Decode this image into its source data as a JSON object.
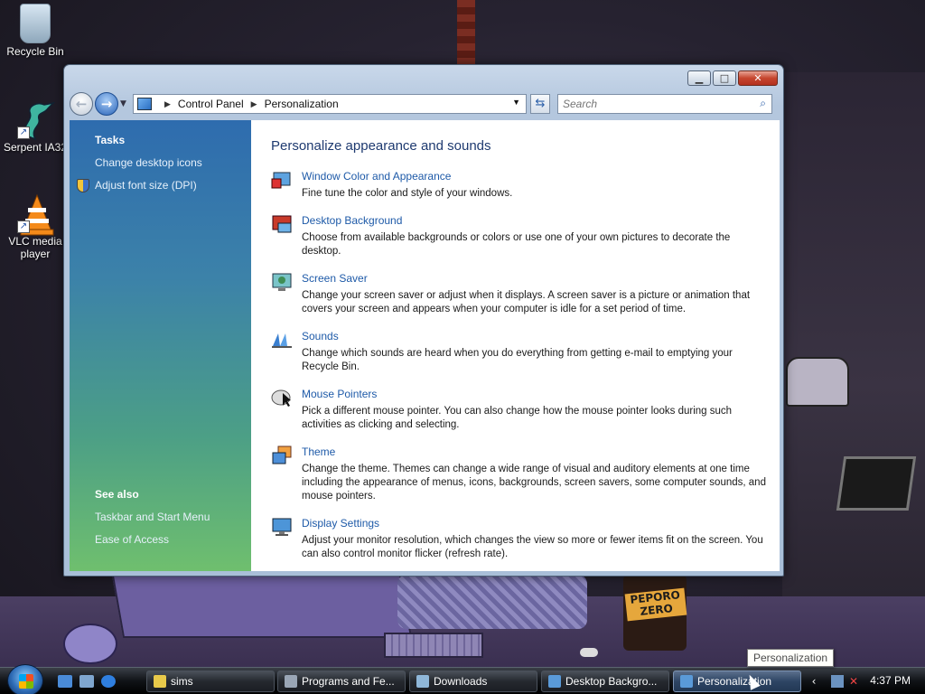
{
  "desktop": {
    "icons": [
      {
        "label": "Recycle Bin",
        "icon": "recycle-bin-icon"
      },
      {
        "label": "Serpent IA32",
        "icon": "serpent-icon"
      },
      {
        "label": "VLC media player",
        "icon": "vlc-icon"
      }
    ],
    "bottle_text": "PEPORO ZERO"
  },
  "window": {
    "address": {
      "root": "Control Panel",
      "current": "Personalization"
    },
    "search_placeholder": "Search",
    "sidebar": {
      "tasks_heading": "Tasks",
      "tasks": [
        "Change desktop icons",
        "Adjust font size (DPI)"
      ],
      "see_also_heading": "See also",
      "see_also": [
        "Taskbar and Start Menu",
        "Ease of Access"
      ]
    },
    "content": {
      "heading": "Personalize appearance and sounds",
      "items": [
        {
          "title": "Window Color and Appearance",
          "desc": "Fine tune the color and style of your windows.",
          "icon": "window-color-icon"
        },
        {
          "title": "Desktop Background",
          "desc": "Choose from available backgrounds or colors or use one of your own pictures to decorate the desktop.",
          "icon": "desktop-background-icon"
        },
        {
          "title": "Screen Saver",
          "desc": "Change your screen saver or adjust when it displays. A screen saver is a picture or animation that covers your screen and appears when your computer is idle for a set period of time.",
          "icon": "screen-saver-icon"
        },
        {
          "title": "Sounds",
          "desc": "Change which sounds are heard when you do everything from getting e-mail to emptying your Recycle Bin.",
          "icon": "sounds-icon"
        },
        {
          "title": "Mouse Pointers",
          "desc": "Pick a different mouse pointer. You can also change how the mouse pointer looks during such activities as clicking and selecting.",
          "icon": "mouse-pointers-icon"
        },
        {
          "title": "Theme",
          "desc": "Change the theme. Themes can change a wide range of visual and auditory elements at one time including the appearance of menus, icons, backgrounds, screen savers, some computer sounds, and mouse pointers.",
          "icon": "theme-icon"
        },
        {
          "title": "Display Settings",
          "desc": "Adjust your monitor resolution, which changes the view so more or fewer items fit on the screen. You can also control monitor flicker (refresh rate).",
          "icon": "display-settings-icon"
        }
      ]
    }
  },
  "taskbar": {
    "tasks": [
      {
        "label": "sims",
        "active": false
      },
      {
        "label": "Programs and Fe...",
        "active": false
      },
      {
        "label": "Downloads",
        "active": false
      },
      {
        "label": "Desktop Backgro...",
        "active": false
      },
      {
        "label": "Personalization",
        "active": true
      }
    ],
    "clock": "4:37 PM",
    "tooltip": "Personalization"
  }
}
